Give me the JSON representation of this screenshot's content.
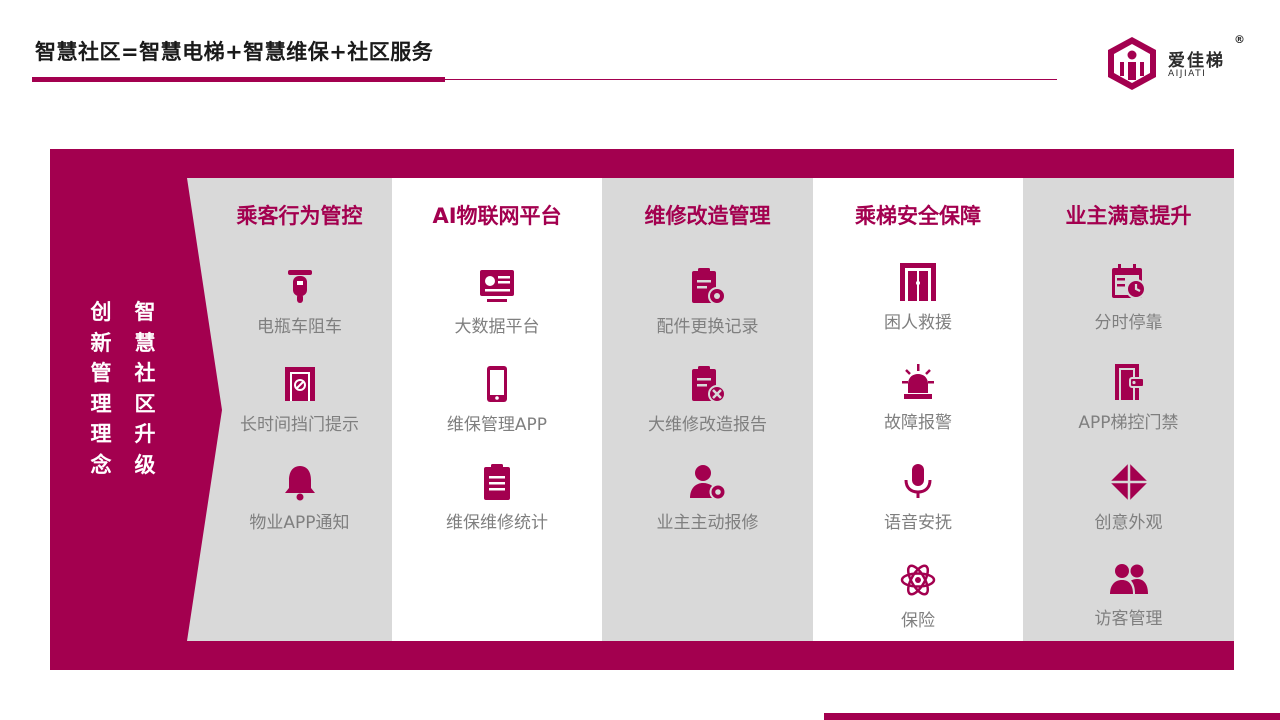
{
  "header": {
    "title": "智慧社区=智慧电梯+智慧维保+社区服务"
  },
  "logo": {
    "name": "爱佳梯",
    "subtitle": "AIJIATI",
    "registered": "®"
  },
  "side": {
    "col1": "创新管理理念",
    "col2": "智慧社区升级"
  },
  "colors": {
    "accent": "#a3004f",
    "gray": "#d9d9d9",
    "label": "#7f7f7f"
  },
  "columns": [
    {
      "title": "乘客行为管控",
      "items": [
        {
          "label": "电瓶车阻车",
          "icon": "scooter-icon"
        },
        {
          "label": "长时间挡门提示",
          "icon": "door-block-icon"
        },
        {
          "label": "物业APP通知",
          "icon": "bell-icon"
        }
      ]
    },
    {
      "title": "AI物联网平台",
      "items": [
        {
          "label": "大数据平台",
          "icon": "dashboard-icon"
        },
        {
          "label": "维保管理APP",
          "icon": "phone-icon"
        },
        {
          "label": "维保维修统计",
          "icon": "clipboard-icon"
        }
      ]
    },
    {
      "title": "维修改造管理",
      "items": [
        {
          "label": "配件更换记录",
          "icon": "clipboard-gear-icon"
        },
        {
          "label": "大维修改造报告",
          "icon": "clipboard-tools-icon"
        },
        {
          "label": "业主主动报修",
          "icon": "user-gear-icon"
        }
      ]
    },
    {
      "title": "乘梯安全保障",
      "items": [
        {
          "label": "困人救援",
          "icon": "elevator-door-icon"
        },
        {
          "label": "故障报警",
          "icon": "alarm-light-icon"
        },
        {
          "label": "语音安抚",
          "icon": "microphone-icon"
        },
        {
          "label": "保险",
          "icon": "atom-icon"
        }
      ]
    },
    {
      "title": "业主满意提升",
      "items": [
        {
          "label": "分时停靠",
          "icon": "calendar-clock-icon"
        },
        {
          "label": "APP梯控门禁",
          "icon": "door-access-icon"
        },
        {
          "label": "创意外观",
          "icon": "diamond-icon"
        },
        {
          "label": "访客管理",
          "icon": "users-icon"
        }
      ]
    }
  ]
}
